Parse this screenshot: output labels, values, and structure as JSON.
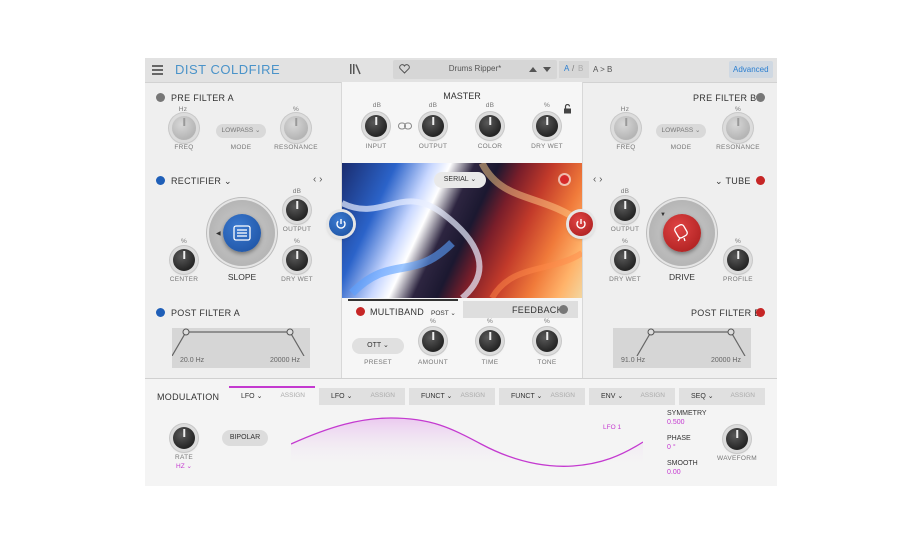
{
  "app": {
    "title": "DIST COLDFIRE",
    "advanced_label": "Advanced"
  },
  "toolbar": {
    "preset": "Drums Ripper*",
    "a_label": "A",
    "slash": "/",
    "b_label": "B",
    "copy_label": "A > B"
  },
  "pre_filter_a": {
    "title": "PRE FILTER A",
    "freq": "FREQ",
    "mode_value": "LOWPASS",
    "mode": "MODE",
    "resonance": "RESONANCE",
    "hz_label": "Hz",
    "pct_label": "%"
  },
  "pre_filter_b": {
    "title": "PRE FILTER B",
    "freq": "FREQ",
    "mode_value": "LOWPASS",
    "mode": "MODE",
    "resonance": "RESONANCE",
    "hz_label": "Hz",
    "pct_label": "%"
  },
  "master": {
    "title": "MASTER",
    "input": "INPUT",
    "output": "OUTPUT",
    "color": "COLOR",
    "dry_wet": "DRY WET",
    "db_label": "dB",
    "pct_label": "%"
  },
  "routing": {
    "mode": "SERIAL"
  },
  "dist_a": {
    "type": "RECTIFIER",
    "main_knob": "SLOPE",
    "output": "OUTPUT",
    "center": "CENTER",
    "dry_wet": "DRY WET",
    "db_label": "dB",
    "pct_label": "%"
  },
  "dist_b": {
    "type": "TUBE",
    "main_knob": "DRIVE",
    "output": "OUTPUT",
    "dry_wet": "DRY WET",
    "profile": "PROFILE",
    "db_label": "dB",
    "pct_label": "%"
  },
  "post_filter_a": {
    "title": "POST FILTER A",
    "low": "20.0 Hz",
    "high": "20000 Hz"
  },
  "post_filter_b": {
    "title": "POST FILTER B",
    "low": "91.0 Hz",
    "high": "20000 Hz"
  },
  "multiband": {
    "title": "MULTIBAND",
    "post": "POST",
    "feedback": "FEEDBACK",
    "preset_value": "OTT",
    "preset": "PRESET",
    "amount": "AMOUNT",
    "time": "TIME",
    "tone": "TONE",
    "pct_label": "%"
  },
  "modulation": {
    "title": "MODULATION",
    "tabs": [
      {
        "name": "LFO",
        "assign": "ASSIGN"
      },
      {
        "name": "LFO",
        "assign": "ASSIGN"
      },
      {
        "name": "FUNCT",
        "assign": "ASSIGN"
      },
      {
        "name": "FUNCT",
        "assign": "ASSIGN"
      },
      {
        "name": "ENV",
        "assign": "ASSIGN"
      },
      {
        "name": "SEQ",
        "assign": "ASSIGN"
      }
    ],
    "rate": "RATE",
    "rate_unit": "HZ",
    "bipolar": "BIPOLAR",
    "lfo_label": "LFO 1",
    "symmetry": "SYMMETRY",
    "symmetry_value": "0.500",
    "phase": "PHASE",
    "phase_value": "0 °",
    "smooth": "SMOOTH",
    "smooth_value": "0.00",
    "waveform": "WAVEFORM"
  },
  "colors": {
    "accent_blue": "#1f5fb8",
    "accent_red": "#c62626",
    "title_blue": "#4a93c9",
    "mod_magenta": "#c43ad0"
  }
}
